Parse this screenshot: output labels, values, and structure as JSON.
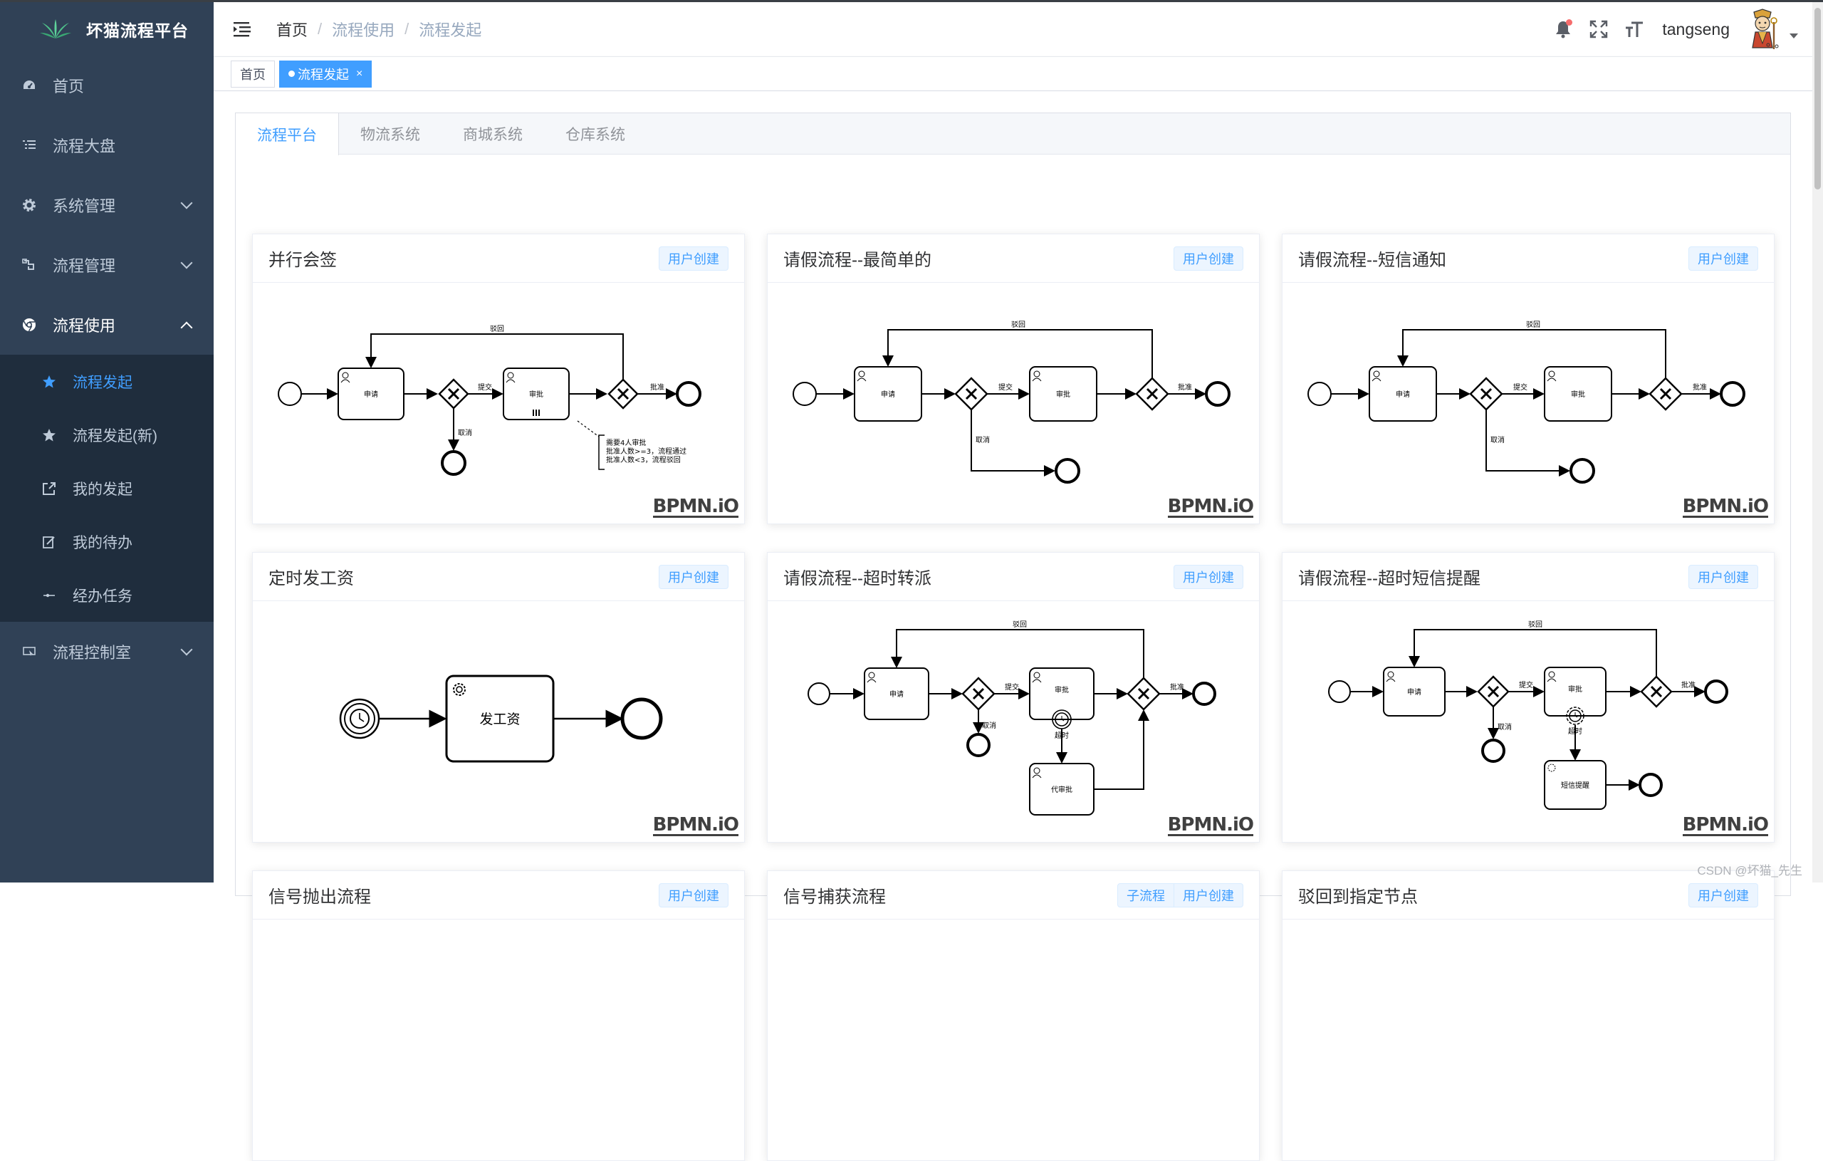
{
  "app": {
    "title": "坏猫流程平台"
  },
  "sidebar": {
    "items": [
      {
        "label": "首页",
        "icon": "dashboard-icon"
      },
      {
        "label": "流程大盘",
        "icon": "list-icon"
      },
      {
        "label": "系统管理",
        "icon": "gear-icon"
      },
      {
        "label": "流程管理",
        "icon": "flow-icon"
      },
      {
        "label": "流程使用",
        "icon": "chrome-icon"
      }
    ],
    "submenu": [
      {
        "label": "流程发起",
        "icon": "star-icon"
      },
      {
        "label": "流程发起(新)",
        "icon": "star-icon"
      },
      {
        "label": "我的发起",
        "icon": "external-link-icon"
      },
      {
        "label": "我的待办",
        "icon": "edit-icon"
      },
      {
        "label": "经办任务",
        "icon": "connection-icon"
      }
    ],
    "last_item": {
      "label": "流程控制室",
      "icon": "monitor-icon"
    }
  },
  "header": {
    "breadcrumb": [
      "首页",
      "流程使用",
      "流程发起"
    ],
    "username": "tangseng"
  },
  "tags": [
    {
      "label": "首页"
    },
    {
      "label": "流程发起",
      "close": "×"
    }
  ],
  "tabs": [
    "流程平台",
    "物流系统",
    "商城系统",
    "仓库系统"
  ],
  "badge_user": "用户创建",
  "badge_sub": "子流程",
  "bpmn_logo": "BPMN.iO",
  "cards": [
    {
      "title": "并行会签"
    },
    {
      "title": "请假流程--最简单的"
    },
    {
      "title": "请假流程--短信通知"
    },
    {
      "title": "定时发工资"
    },
    {
      "title": "请假流程--超时转派"
    },
    {
      "title": "请假流程--超时短信提醒"
    },
    {
      "title": "信号抛出流程"
    },
    {
      "title": "信号捕获流程"
    },
    {
      "title": "驳回到指定节点"
    }
  ],
  "diagram_labels": {
    "reject": "驳回",
    "apply": "申请",
    "submit": "提交",
    "approve": "审批",
    "cancel": "取消",
    "pass": "批准",
    "note_line1": "需要4人审批",
    "note_line2": "批准人数>=3，流程通过",
    "note_line3": "批准人数<3，流程驳回",
    "pay": "发工资",
    "proxy_approve": "代审批",
    "timeout": "超时",
    "sms": "短信提醒"
  },
  "watermark": "CSDN @坏猫_先生"
}
